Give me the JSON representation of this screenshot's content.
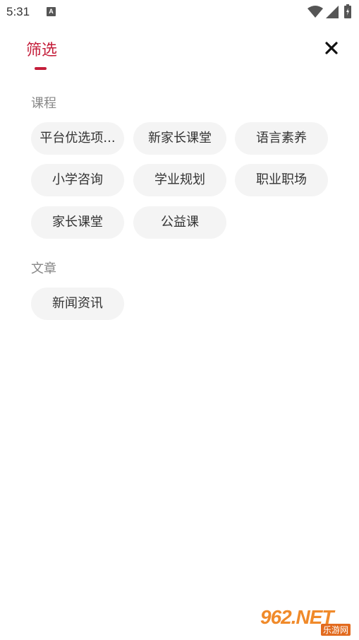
{
  "status_bar": {
    "time": "5:31",
    "notification_icon_letter": "A",
    "icons": [
      "wifi-icon",
      "signal-icon",
      "battery-charging-icon"
    ]
  },
  "header": {
    "title": "筛选",
    "accent_color": "#c41e3a",
    "close_icon": "close-icon"
  },
  "sections": [
    {
      "title": "课程",
      "chips": [
        "平台优选项...",
        "新家长课堂",
        "语言素养",
        "小学咨询",
        "学业规划",
        "职业职场",
        "家长课堂",
        "公益课"
      ]
    },
    {
      "title": "文章",
      "chips": [
        "新闻资讯"
      ]
    }
  ],
  "watermark": {
    "main": "962.NET",
    "sub": "乐游网"
  }
}
